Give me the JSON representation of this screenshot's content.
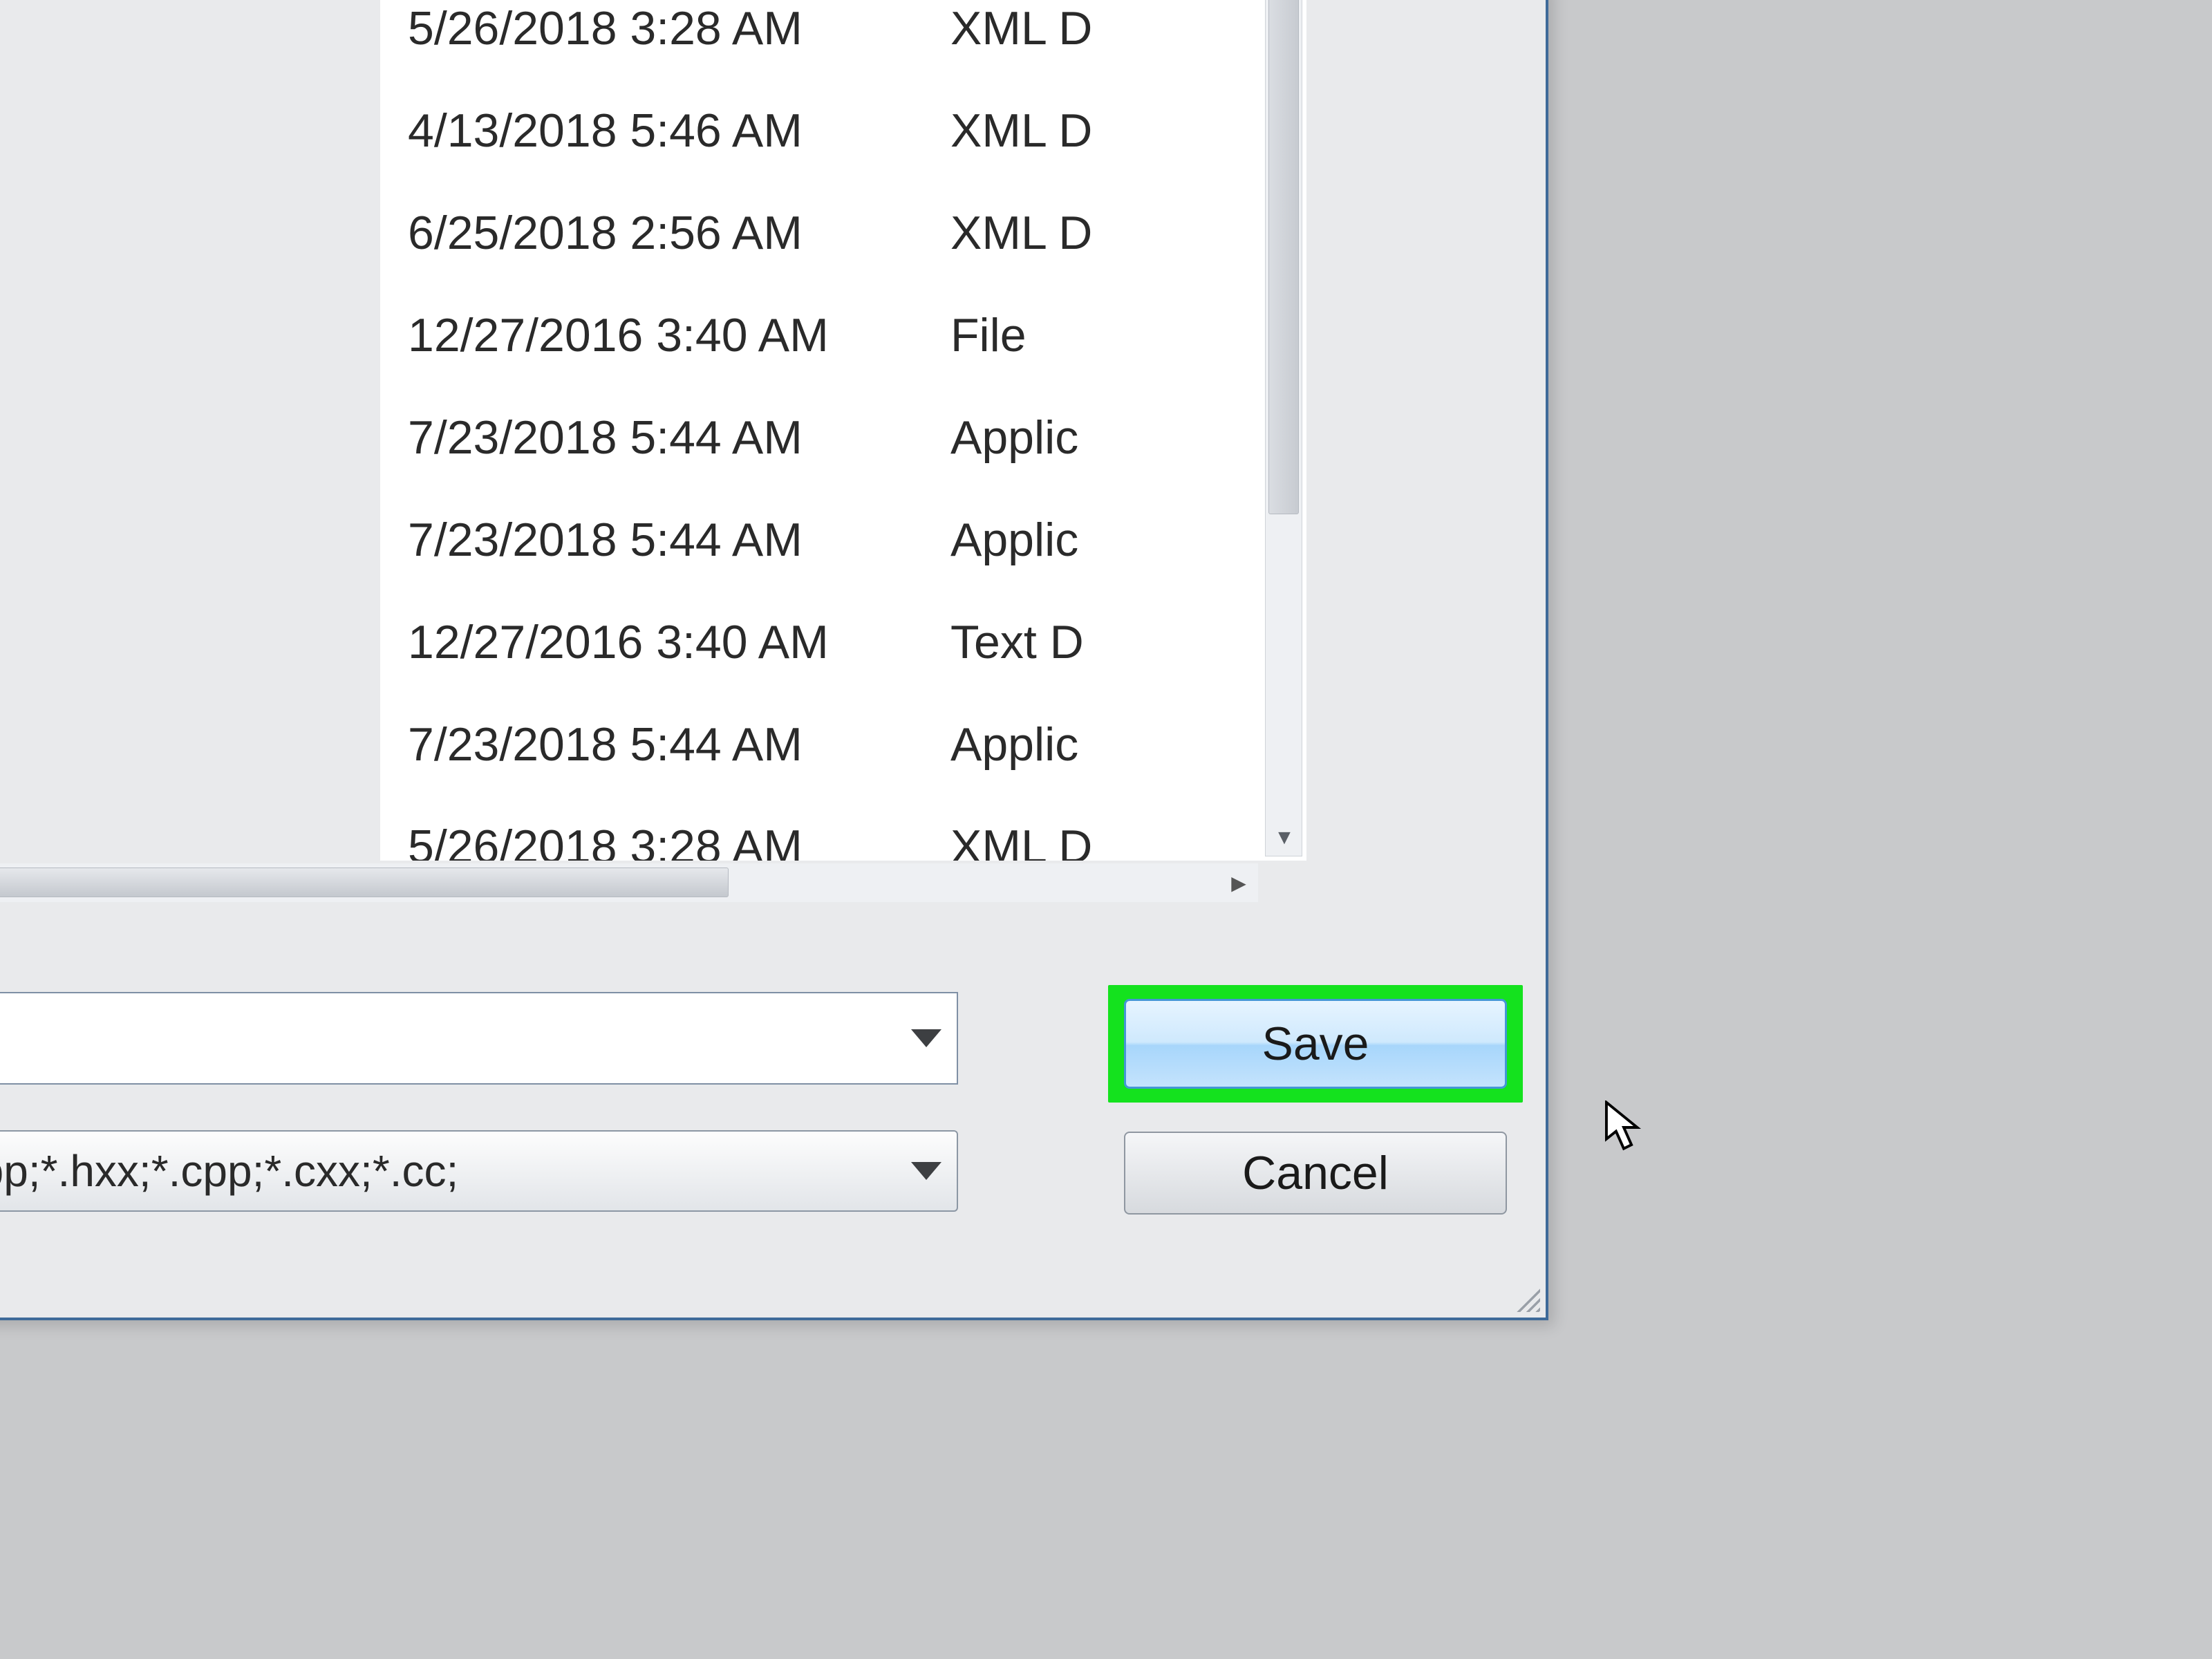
{
  "file_list": {
    "rows": [
      {
        "date": "5/26/2018 3:28 AM",
        "type": "XML D"
      },
      {
        "date": "4/13/2018 5:46 AM",
        "type": "XML D"
      },
      {
        "date": "6/25/2018 2:56 AM",
        "type": "XML D"
      },
      {
        "date": "12/27/2016 3:40 AM",
        "type": "File"
      },
      {
        "date": "7/23/2018 5:44 AM",
        "type": "Applic"
      },
      {
        "date": "7/23/2018 5:44 AM",
        "type": "Applic"
      },
      {
        "date": "12/27/2016 3:40 AM",
        "type": "Text D"
      },
      {
        "date": "7/23/2018 5:44 AM",
        "type": "Applic"
      },
      {
        "date": "5/26/2018 3:28 AM",
        "type": "XML D"
      }
    ]
  },
  "filename_field": {
    "value": ""
  },
  "filetype_field": {
    "text": " (*.h;*.hpp;*.hxx;*.cpp;*.cxx;*.cc;"
  },
  "buttons": {
    "save": "Save",
    "cancel": "Cancel"
  }
}
